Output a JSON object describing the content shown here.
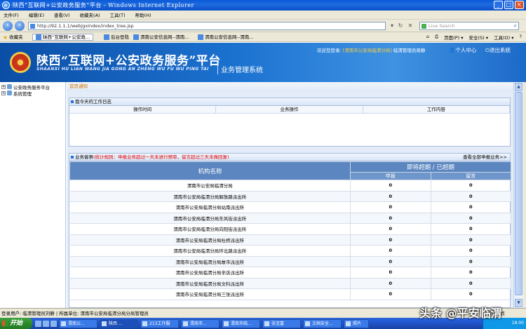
{
  "window": {
    "title": "陕西“互联网+公安政务服务”平台 - Windows Internet Explorer",
    "ie_glyph": "e",
    "icons": [
      "ie-icon",
      "minimize-icon",
      "maximize-icon",
      "close-icon"
    ]
  },
  "menu": [
    "文件(F)",
    "编辑(E)",
    "查看(V)",
    "收藏夹(A)",
    "工具(T)",
    "帮助(H)"
  ],
  "address": {
    "url": "http://92.1.1.1/webjgxindex/index_tree.jsp",
    "search_placeholder": "Live Search",
    "go_glyph": "→",
    "search_glyph": "⌕"
  },
  "favorites": {
    "label": "收藏夹",
    "tabs": [
      {
        "label": "陕西“互联网+公安政..."
      },
      {
        "label": "后台登陆"
      },
      {
        "label": "渭南公安信息网--渭南..."
      },
      {
        "label": "渭南公安信息网--渭南..."
      }
    ],
    "tools": [
      "页面(P) ▾",
      "安全(S) ▾",
      "工具(O) ▾",
      "?"
    ]
  },
  "header": {
    "title": "陕西“互联网+公安政务服务”平台",
    "pinyin": "SHAANXI HU LIAN WANG JIA GONG AN ZHENG WU FU WU PING TAI",
    "subtitle": "业务管理系统",
    "welcome_prefix": "欢迎您登录: ",
    "welcome_unit": "[渭南市公安局临渭分局]",
    "welcome_role": " 临渭管理员周静",
    "personal_center": "个人中心",
    "logout": "退出系统"
  },
  "tree": [
    {
      "label": "公安政务服务平台"
    },
    {
      "label": "系统管理"
    }
  ],
  "breadcrumb": "首页通知",
  "log_panel": {
    "title": "我今天的工作日志",
    "columns": [
      "操作时间",
      "业务操作",
      "工作内容"
    ]
  },
  "warn_panel": {
    "title": "业务督察",
    "warn_text": "(统计规则：申报业务超过一天未进行预审，留言超过三天未做回复)",
    "view_all": "查看全部申报业务>>",
    "col_org": "机构名称",
    "col_group": "即将超期 / 已超期",
    "col_apply": "申报",
    "col_msg": "留言",
    "rows": [
      {
        "name": "渭南市公安局临渭分局",
        "apply": "0",
        "msg": "0"
      },
      {
        "name": "渭南市公安局临渭分局解放路派出所",
        "apply": "0",
        "msg": "0"
      },
      {
        "name": "渭南市公安局临渭分局站南派出所",
        "apply": "0",
        "msg": "0"
      },
      {
        "name": "渭南市公安局临渭分局东风街派出所",
        "apply": "0",
        "msg": "0"
      },
      {
        "name": "渭南市公安局临渭分局向阳街派出所",
        "apply": "0",
        "msg": "0"
      },
      {
        "name": "渭南市公安局临渭分局杜桥派出所",
        "apply": "0",
        "msg": "0"
      },
      {
        "name": "渭南市公安局临渭分局环北路派出所",
        "apply": "0",
        "msg": "0"
      },
      {
        "name": "渭南市公安局临渭分局故市派出所",
        "apply": "0",
        "msg": "0"
      },
      {
        "name": "渭南市公安局临渭分局辛店派出所",
        "apply": "0",
        "msg": "0"
      },
      {
        "name": "渭南市公安局临渭分局文科派出所",
        "apply": "0",
        "msg": "0"
      },
      {
        "name": "渭南市公安局临渭分局三张派出所",
        "apply": "0",
        "msg": "0"
      }
    ]
  },
  "status": {
    "text": "登录用户: 临渭管理员刘静  |  所属单位: 渭南市公安局临渭分局分局管理员",
    "zone": "可信站点"
  },
  "taskbar": {
    "start": "开始",
    "items": [
      "渭南公...",
      "陕西 ...",
      "213工作服",
      "渭南市...",
      "渭南市临...",
      "张宝富",
      "文档安全...",
      "照片"
    ],
    "clock": "18:00"
  },
  "watermark": "头条 @平安临渭"
}
